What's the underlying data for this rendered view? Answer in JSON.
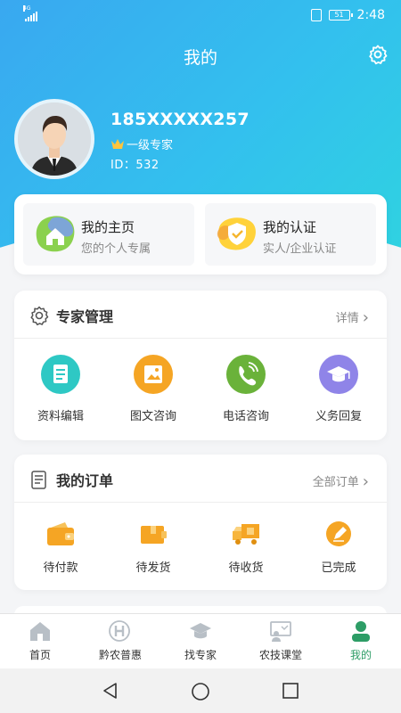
{
  "status_bar": {
    "signal": "4G",
    "battery": "51",
    "time": "2:48"
  },
  "header": {
    "title": "我的"
  },
  "profile": {
    "name": "185XXXXX257",
    "level": "一级专家",
    "id": "ID：532"
  },
  "quick_links": [
    {
      "title": "我的主页",
      "subtitle": "您的个人专属",
      "icon": "home-icon"
    },
    {
      "title": "我的认证",
      "subtitle": "实人/企业认证",
      "icon": "shield-check-icon"
    }
  ],
  "expert_mgmt": {
    "title": "专家管理",
    "more": "详情",
    "items": [
      {
        "label": "资料编辑",
        "icon": "document-icon",
        "color": "#2ec8c4"
      },
      {
        "label": "图文咨询",
        "icon": "image-text-icon",
        "color": "#f5a524"
      },
      {
        "label": "电话咨询",
        "icon": "phone-icon",
        "color": "#6ab23a"
      },
      {
        "label": "义务回复",
        "icon": "graduation-cap-icon",
        "color": "#8f84e8"
      }
    ]
  },
  "orders": {
    "title": "我的订单",
    "more": "全部订单",
    "items": [
      {
        "label": "待付款",
        "icon": "wallet-icon"
      },
      {
        "label": "待发货",
        "icon": "package-icon"
      },
      {
        "label": "待收货",
        "icon": "truck-icon"
      },
      {
        "label": "已完成",
        "icon": "pencil-check-icon"
      }
    ]
  },
  "tabs": [
    {
      "label": "首页",
      "icon": "home-icon"
    },
    {
      "label": "黔农普惠",
      "icon": "benefit-icon"
    },
    {
      "label": "找专家",
      "icon": "graduation-cap-icon"
    },
    {
      "label": "农技课堂",
      "icon": "classroom-icon"
    },
    {
      "label": "我的",
      "icon": "user-icon",
      "active": true
    }
  ],
  "colors": {
    "accent": "#2d9d66",
    "hero_start": "#39a8f0",
    "hero_end": "#2fd3e0",
    "order_orange": "#f5a524"
  }
}
